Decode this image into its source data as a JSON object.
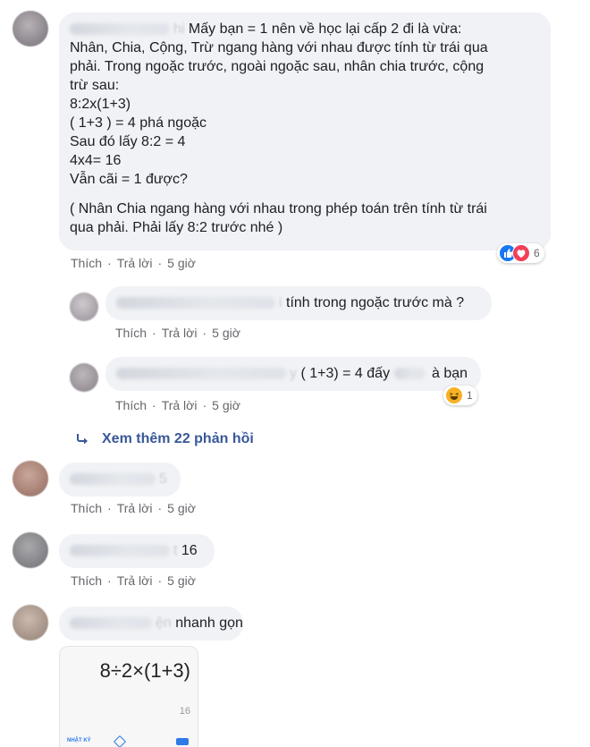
{
  "comments": [
    {
      "name_tail": "hi",
      "lines": [
        "Mấy bạn = 1 nên về học lại cấp 2 đi là vừa:",
        "Nhân, Chia, Cộng, Trừ ngang hàng với nhau được tính từ trái qua",
        "phải. Trong ngoặc trước, ngoài ngoặc sau, nhân chia trước, cộng",
        "trừ sau:",
        "8:2x(1+3)",
        "( 1+3 ) = 4 phá ngoặc",
        "Sau đó lấy 8:2 = 4",
        "4x4= 16",
        "Vẫn cãi = 1 được?"
      ],
      "note_lines": [
        "( Nhân Chia ngang hàng với nhau trong phép toán trên tính từ trái",
        "qua phải. Phải lấy 8:2 trước nhé )"
      ],
      "reaction_count": "6",
      "like": "Thích",
      "reply": "Trả lời",
      "time": "5 giờ"
    },
    {
      "name_tail": "i",
      "text": "tính trong ngoặc trước mà ?",
      "like": "Thích",
      "reply": "Trả lời",
      "time": "5 giờ"
    },
    {
      "name_tail": "y",
      "text": "( 1+3) = 4 đấy",
      "text_tail": "à bạn",
      "reaction_count": "1",
      "like": "Thích",
      "reply": "Trả lời",
      "time": "5 giờ"
    },
    {
      "name_tail": "5",
      "like": "Thích",
      "reply": "Trả lời",
      "time": "5 giờ"
    },
    {
      "name_tail": "t",
      "text": "16",
      "like": "Thích",
      "reply": "Trả lời",
      "time": "5 giờ"
    },
    {
      "name_tail": "ện",
      "text": "nhanh gọn",
      "calc_expression": "8÷2×(1+3)",
      "calc_result": "16",
      "calc_history": "NHẬT KÝ"
    }
  ],
  "more_replies": "Xem thêm 22 phản hồi",
  "colors": {
    "bubble": "#f0f2f5",
    "link": "#385898",
    "meta": "#65676b",
    "like_blue": "#1877f2",
    "love_red": "#f33e58",
    "haha_yellow": "#f7b125"
  }
}
